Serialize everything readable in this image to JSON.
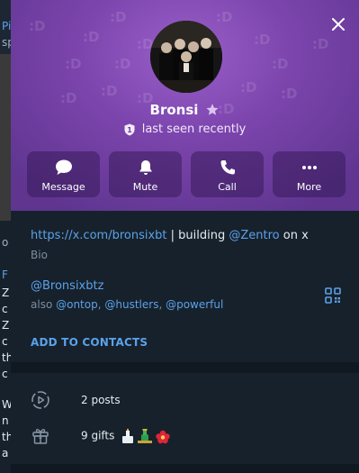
{
  "background_chat": {
    "snippets": [
      {
        "text": "Pi",
        "tone": "blue"
      },
      {
        "text": "sp",
        "tone": "grey"
      },
      {
        "text": "o",
        "tone": "grey"
      },
      {
        "text": "F",
        "tone": "blue"
      },
      {
        "text": "Z",
        "tone": "white"
      },
      {
        "text": "c",
        "tone": "white"
      },
      {
        "text": "Z",
        "tone": "white"
      },
      {
        "text": "c",
        "tone": "white"
      },
      {
        "text": "th",
        "tone": "white"
      },
      {
        "text": "c",
        "tone": "white"
      },
      {
        "text": "W",
        "tone": "white"
      },
      {
        "text": "n",
        "tone": "white"
      },
      {
        "text": "th",
        "tone": "white"
      },
      {
        "text": "a",
        "tone": "white"
      }
    ]
  },
  "profile": {
    "name": "Bronsi",
    "badge_icon": "star-icon",
    "status_icon": "shield-badge-icon",
    "status_badge_number": "1",
    "status": "last seen recently",
    "pattern_glyph": ":D",
    "header_color": "#7c45ad"
  },
  "actions": [
    {
      "label": "Message",
      "icon": "chat-bubble-icon"
    },
    {
      "label": "Mute",
      "icon": "bell-icon"
    },
    {
      "label": "Call",
      "icon": "phone-icon"
    },
    {
      "label": "More",
      "icon": "more-dots-icon"
    }
  ],
  "info": {
    "bio_link": "https://x.com/bronsixbt",
    "bio_mid": " | building ",
    "bio_mention": "@Zentro",
    "bio_end": " on x",
    "bio_label": "Bio",
    "username": "@Bronsixbtz",
    "also_prefix": "also ",
    "also_1": "@ontop",
    "sep_1": ", ",
    "also_2": "@hustlers",
    "sep_2": ", ",
    "also_3": "@powerful",
    "add_contact": "ADD TO CONTACTS"
  },
  "stats": {
    "posts": "2 posts",
    "gifts": "9 gifts"
  },
  "colors": {
    "accent": "#5aa2ea",
    "panel": "#17212b",
    "muted": "#7d8e9e"
  }
}
